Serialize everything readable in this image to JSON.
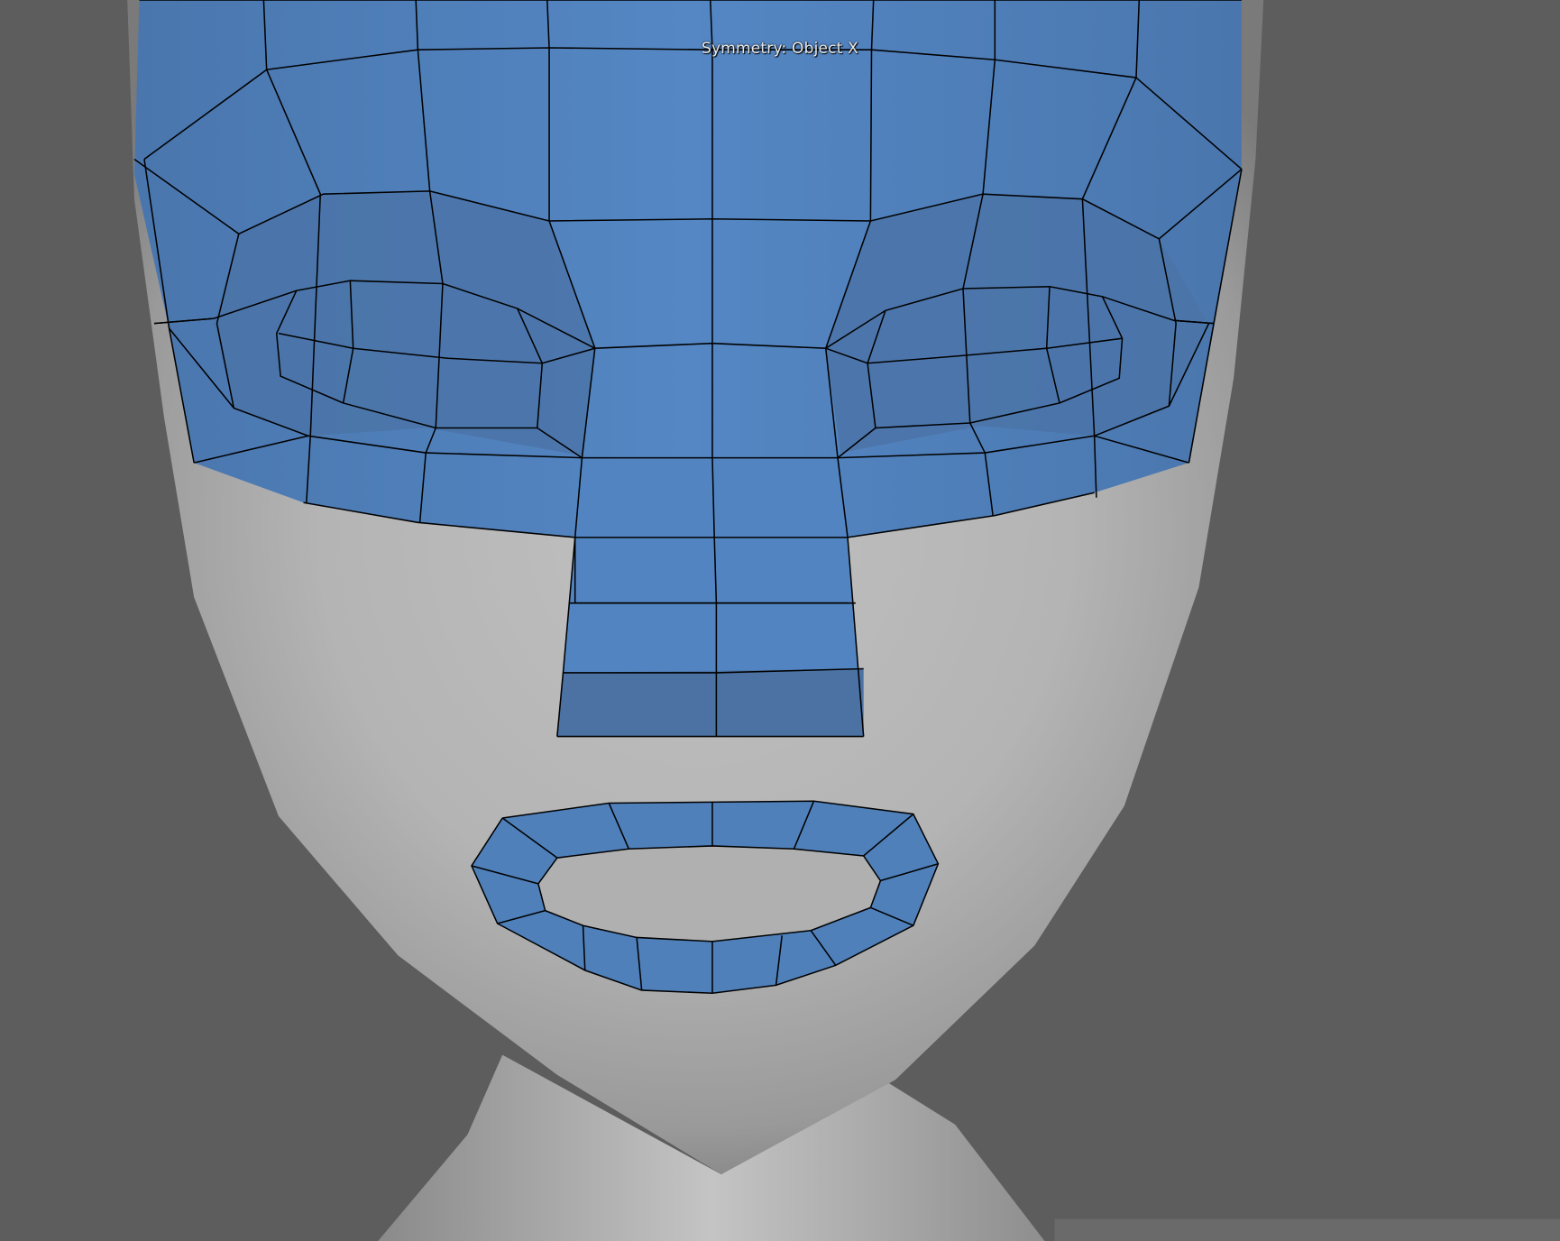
{
  "viewport": {
    "hud_message": "Symmetry: Object X",
    "background_color": "#5d5d5d",
    "mesh_color": "#f0f0f0",
    "selection_color": "#4f80ba",
    "wire_color": "#000000"
  },
  "model": {
    "name": "head-mesh",
    "selected_regions": [
      "forehead-and-eyes",
      "nose-bridge",
      "mouth-ring"
    ]
  }
}
